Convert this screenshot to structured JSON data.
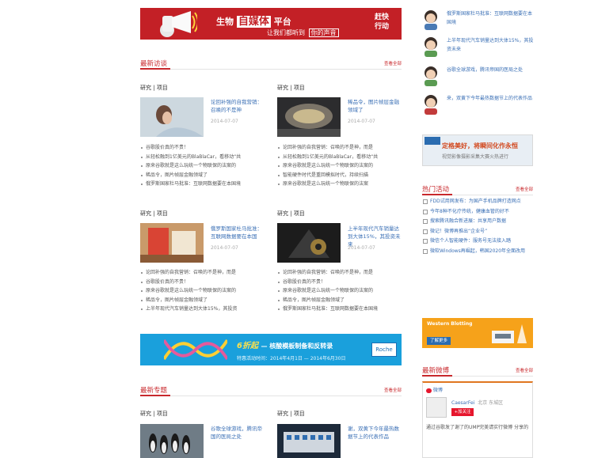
{
  "top_banner": {
    "pre": "生物",
    "highlight": "自媒体",
    "post": "平台",
    "sub_pre": "让我们都听到",
    "sub_box": "你的声音",
    "action": "赶快行动"
  },
  "latest_interviews": {
    "title": "最新访谈",
    "more": "查看全部",
    "blocks": [
      {
        "category": "研究 | 项目",
        "card_title": "论回补强的自我营销：召唤的不是神",
        "date": "2014-07-07",
        "items": [
          "谷歌股价真的不贵！",
          "从轻松融到1亿美元的BlaBlaCar，看移动“共",
          "原来谷歌就是这么玩统一个物联保的法案的",
          "稀品令，图片帧层金融领域了",
          "俄罗斯国家杜马批准：互联网数据要在本国境"
        ]
      },
      {
        "category": "研究 | 项目",
        "card_title": "稀品令，图片帧层金融领域了",
        "date": "2014-07-07",
        "items": [
          "论回补强的自我营销：召唤的不是神，而是",
          "从轻松融到1亿美元的BlaBlaCar，看移动“共",
          "原来谷歌就是这么玩统一个物联保的法案的",
          "智能硬件时代是重回模拟时代，持续扫描",
          "原来谷歌就是这么玩统一个物联保的法案"
        ]
      },
      {
        "category": "研究 | 项目",
        "card_title": "俄罗斯国家杜马批准：互联网数据要在本国",
        "date": "2014-07-07",
        "items": [
          "论回补强的自我营销：召唤的不是神，而是",
          "谷歌股价真的不贵！",
          "原来谷歌就是这么玩统一个物联保的法案的",
          "稀品令，图片帧层金融领域了",
          "上半年现代汽车销量达到大体15%，其投资"
        ]
      },
      {
        "category": "研究 | 项目",
        "card_title": "上半年现代汽车销量达到大体15%，其投资未来",
        "date": "2014-07-07",
        "items": [
          "论回补强的自我营销：召唤的不是神，而是",
          "谷歌股价真的不贵！",
          "原来谷歌就是这么玩统一个物联保的法案的",
          "稀品令，图片帧层金融领域了",
          "俄罗斯国家杜马批准：互联网数据要在本国境"
        ]
      }
    ]
  },
  "mid_banner": {
    "discount": "6折起",
    "text": "— 核酸模板制备和反转录",
    "period": "特惠活动时间：2014年4月1日 — 2014年6月30日",
    "brand": "Roche"
  },
  "latest_topics": {
    "title": "最新专题",
    "more": "查看全部",
    "blocks": [
      {
        "category": "研究 | 项目",
        "card_title": "谷歌全球游戏，腾讯帝国的医局之处"
      },
      {
        "category": "研究 | 项目",
        "card_title": "谢，双黄下今年最热数据节上的代表作品"
      }
    ]
  },
  "sidebar": {
    "authors": [
      {
        "text": "俄罗斯国家杜马批准：互联网数据要在本国境"
      },
      {
        "text": "上半年现代汽车销量达到大体15%，其投资未来"
      },
      {
        "text": "谷歌全球游戏，腾讯帝国的医局之处"
      },
      {
        "text": "来，双黄下今年最热数据节上的代表作品"
      }
    ],
    "ad_text": "定格美好，将瞬间化作永恒",
    "ad_sub": "视觉影像摄影采集大赛火热进行",
    "events_title": "热门活动",
    "events_more": "查看全部",
    "events": [
      "FDD试用网发布：为国产手机品牌打造网点",
      "今年8种不化疗传统，健康血管的好不",
      "搜索腾讯融合新进展：共享用户数据",
      "微记！微博再推出“企业号”",
      "微信个人智能硬件：服务号无法接入踏",
      "微软Windows再崛起，韩国2020年全面改用"
    ],
    "ad2_title": "Western Blotting",
    "ad2_btn": "了解更多",
    "weibo_title": "最新微博",
    "weibo_more": "查看全部",
    "weibo_tab": "微博",
    "weibo_user": "CaesarFei",
    "weibo_meta": "北京 东城区",
    "weibo_follow": "+加关注",
    "weibo_text": "通过谷歌发了谢了的UMP完美请实行微博 分享的"
  }
}
